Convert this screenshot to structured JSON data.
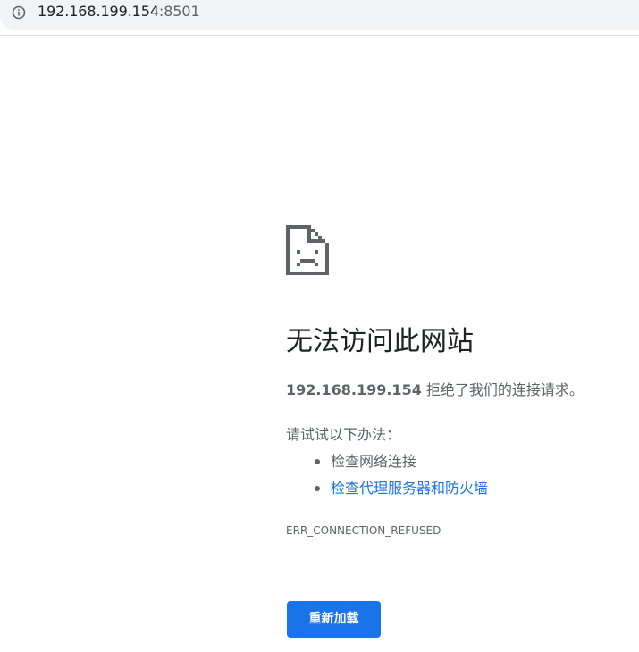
{
  "address_bar": {
    "host": "192.168.199.154",
    "port": ":8501",
    "icon": "info-icon"
  },
  "error": {
    "icon": "sad-page-icon",
    "title": "无法访问此网站",
    "host": "192.168.199.154",
    "message_suffix": " 拒绝了我们的连接请求。",
    "suggestions_heading": "请试试以下办法：",
    "suggestions": [
      {
        "label": "检查网络连接",
        "is_link": false
      },
      {
        "label": "检查代理服务器和防火墙",
        "is_link": true
      }
    ],
    "code": "ERR_CONNECTION_REFUSED",
    "reload_label": "重新加载"
  },
  "colors": {
    "link": "#1a73e8",
    "button": "#1a73e8",
    "secondary_text": "#5f6368",
    "title_text": "#202124",
    "toolbar": "#f1f3f4"
  }
}
